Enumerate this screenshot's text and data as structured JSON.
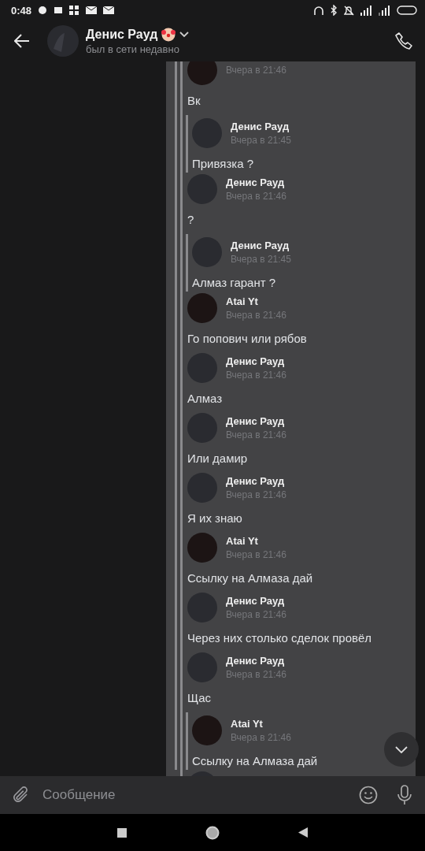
{
  "status_bar": {
    "time": "0:48"
  },
  "header": {
    "name": "Денис Рауд",
    "status": "был в сети недавно"
  },
  "messages": [
    {
      "kind": "plain",
      "color": "#1c1414",
      "time": "Вчера в 21:46",
      "text": "Вк"
    },
    {
      "kind": "nested",
      "color": "#2a2b30",
      "name": "Денис Рауд",
      "time": "Вчера в 21:45",
      "text": "Привязка ?"
    },
    {
      "kind": "plain",
      "color": "#2a2b30",
      "name": "Денис Рауд",
      "time": "Вчера в 21:46",
      "text": "?"
    },
    {
      "kind": "nested",
      "color": "#2a2b30",
      "name": "Денис Рауд",
      "time": "Вчера в 21:45",
      "text": "Алмаз гарант ?"
    },
    {
      "kind": "plain",
      "color": "#1c1414",
      "name": "Atai Yt",
      "time": "Вчера в 21:46",
      "text": "Го попович или рябов"
    },
    {
      "kind": "plain",
      "color": "#2a2b30",
      "name": "Денис Рауд",
      "time": "Вчера в 21:46",
      "text": "Алмаз"
    },
    {
      "kind": "plain",
      "color": "#2a2b30",
      "name": "Денис Рауд",
      "time": "Вчера в 21:46",
      "text": "Или дамир"
    },
    {
      "kind": "plain",
      "color": "#2a2b30",
      "name": "Денис Рауд",
      "time": "Вчера в 21:46",
      "text": "Я их знаю"
    },
    {
      "kind": "plain",
      "color": "#1c1414",
      "name": "Atai Yt",
      "time": "Вчера в 21:46",
      "text": "Ссылку на Алмаза дай"
    },
    {
      "kind": "plain",
      "color": "#2a2b30",
      "name": "Денис Рауд",
      "time": "Вчера в 21:46",
      "text": "Через них столько сделок провёл"
    },
    {
      "kind": "plain",
      "color": "#2a2b30",
      "name": "Денис Рауд",
      "time": "Вчера в 21:46",
      "text": "Щас"
    },
    {
      "kind": "nested",
      "color": "#1c1414",
      "name": "Atai Yt",
      "time": "Вчера в 21:46",
      "text": "Ссылку на Алмаза дай"
    }
  ],
  "composer": {
    "placeholder": "Сообщение"
  }
}
